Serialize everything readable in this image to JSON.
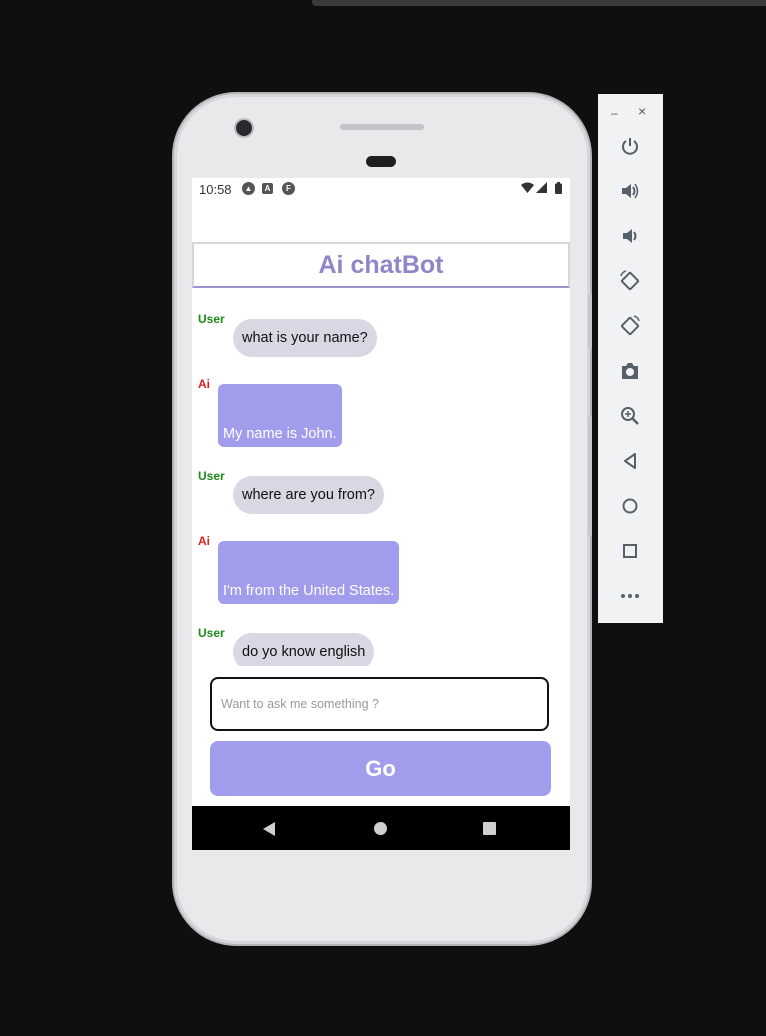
{
  "status_bar": {
    "time": "10:58",
    "left_icons": [
      "android-notification-icon",
      "a-notification-icon",
      "f-notification-icon"
    ],
    "right_icons": [
      "wifi-icon",
      "signal-icon",
      "battery-icon"
    ]
  },
  "app": {
    "title": "Ai chatBot",
    "messages": [
      {
        "sender": "User",
        "text": "what is your name?"
      },
      {
        "sender": "Ai",
        "text": "My name is John."
      },
      {
        "sender": "User",
        "text": "where are you from?"
      },
      {
        "sender": "Ai",
        "text": "I'm from the United States."
      },
      {
        "sender": "User",
        "text": "do yo know english"
      }
    ],
    "input": {
      "placeholder": "Want to ask me something ?",
      "value": ""
    },
    "go_button": "Go"
  },
  "nav_bar": {
    "icons": [
      "back-icon",
      "home-icon",
      "recents-icon"
    ]
  },
  "emulator_toolbar": {
    "window_controls": [
      "minimize-icon",
      "close-icon"
    ],
    "minimize_label": "–",
    "close_label": "×",
    "buttons": [
      "power-icon",
      "volume-up-icon",
      "volume-down-icon",
      "rotate-left-icon",
      "rotate-right-icon",
      "screenshot-icon",
      "zoom-icon",
      "back-icon",
      "home-icon",
      "overview-icon",
      "more-icon"
    ]
  },
  "colors": {
    "accent": "#a29ced",
    "title": "#8e86c8",
    "user_label": "#1b8a1b",
    "ai_label": "#e01e1e",
    "user_bubble": "#d8d7e3"
  }
}
